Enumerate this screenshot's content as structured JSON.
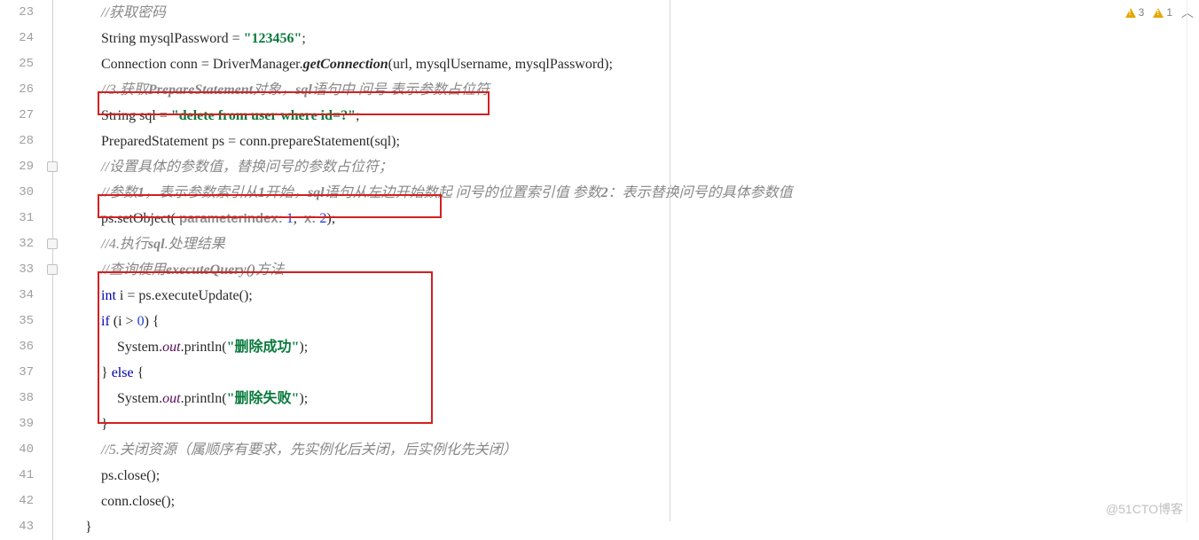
{
  "gutter": {
    "start": 23,
    "end": 43
  },
  "warnings": {
    "count1": "3",
    "count2": "1"
  },
  "code": {
    "l23_comment": "//获取密码",
    "l24_type": "String",
    "l24_var": " mysqlPassword = ",
    "l24_str": "\"123456\"",
    "l24_end": ";",
    "l25_a": "Connection conn = DriverManager.",
    "l25_b": "getConnection",
    "l25_c": "(url, mysqlUsername, mysqlPassword);",
    "l26_comment_a": "//3.获取",
    "l26_comment_b": "PrepareStatement",
    "l26_comment_c": "对象，",
    "l26_comment_d": "sql",
    "l26_comment_e": "语句中 问号 表示参数占位符",
    "l27_type": "String",
    "l27_var": " sql = ",
    "l27_str": "\"delete from user where id=?\"",
    "l27_end": ";",
    "l28": "PreparedStatement ps = conn.prepareStatement(sql);",
    "l29_comment": "//设置具体的参数值，替换问号的参数占位符；",
    "l30_comment_a": "//参数",
    "l30_comment_b": "1",
    "l30_comment_c": "，表示参数索引从",
    "l30_comment_d": "1",
    "l30_comment_e": "开始，",
    "l30_comment_f": "sql",
    "l30_comment_g": "语句从左边开始数起 问号的位置索引值 参数",
    "l30_comment_h": "2",
    "l30_comment_i": "：表示替换问号的具体参数值",
    "l31_a": "ps.setObject( ",
    "l31_hint1": "parameterIndex: ",
    "l31_val1": "1",
    "l31_mid": ",  ",
    "l31_hint2": "x: ",
    "l31_val2": "2",
    "l31_end": ");",
    "l32_comment_a": "//4.执行",
    "l32_comment_b": "sql",
    "l32_comment_c": ".处理结果",
    "l33_comment_a": "//查询使用",
    "l33_comment_b": "executeQuery()",
    "l33_comment_c": "方法",
    "l34_kw": "int",
    "l34_rest": " i = ps.executeUpdate();",
    "l35_kw": "if",
    "l35_a": " (i > ",
    "l35_num": "0",
    "l35_b": ") {",
    "l36_a": "System.",
    "l36_out": "out",
    "l36_b": ".println(",
    "l36_str": "\"删除成功\"",
    "l36_c": ");",
    "l37_a": "} ",
    "l37_kw": "else",
    "l37_b": " {",
    "l38_a": "System.",
    "l38_out": "out",
    "l38_b": ".println(",
    "l38_str": "\"删除失败\"",
    "l38_c": ");",
    "l39": "}",
    "l40_comment_a": "//5.关闭资源（属顺序有要求，先实例化后关闭，后实例化先关闭）",
    "l41": "ps.close();",
    "l42": "conn.close();",
    "l43": "}"
  },
  "watermark": "@51CTO博客"
}
